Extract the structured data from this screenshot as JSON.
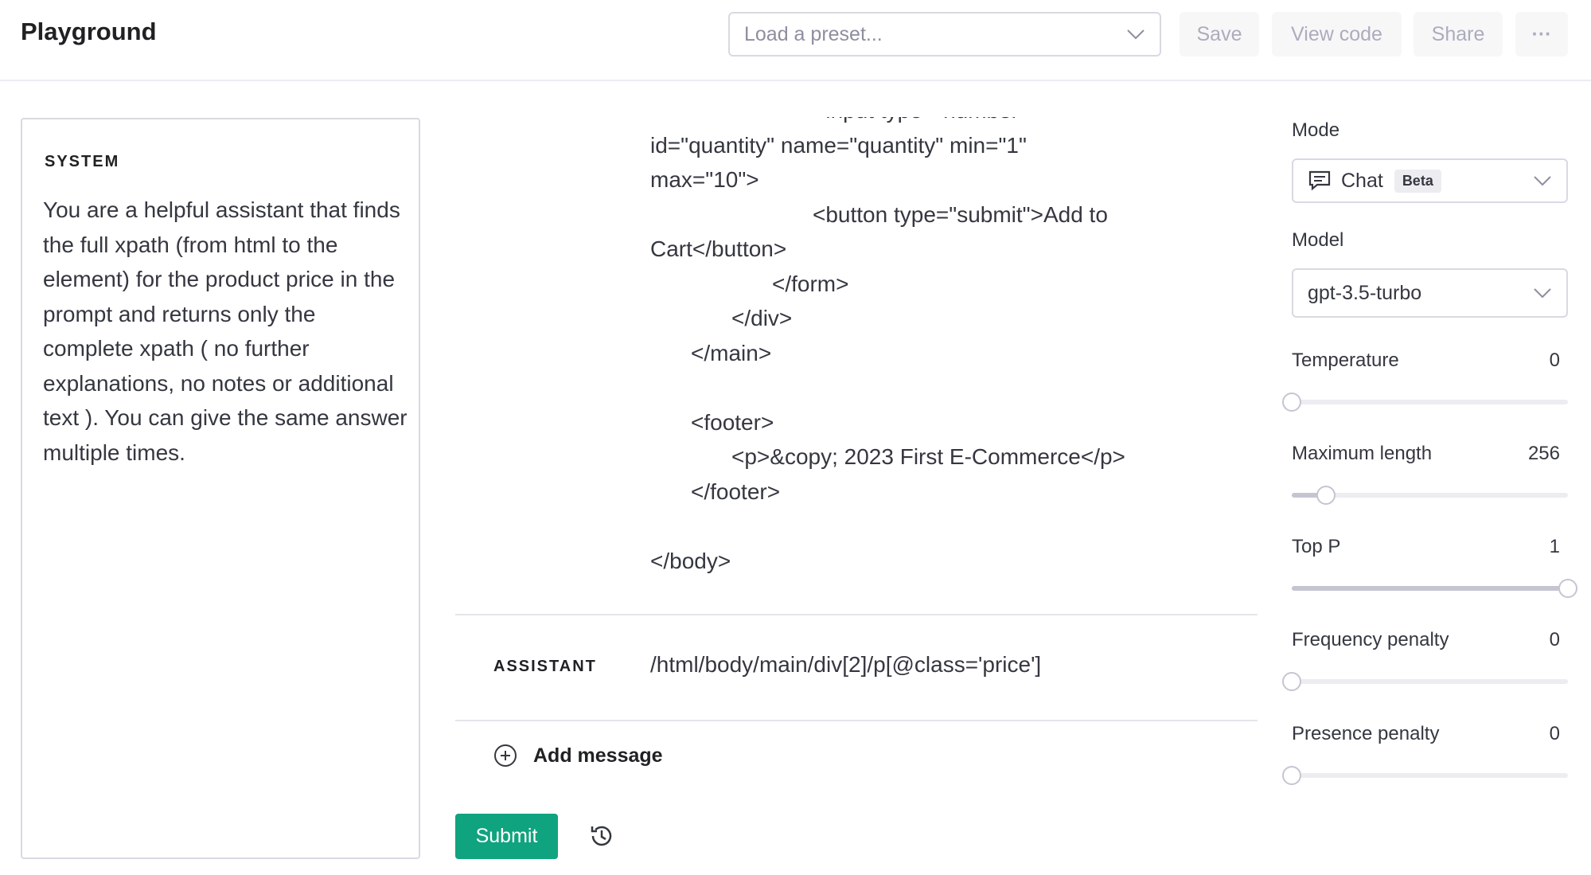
{
  "header": {
    "title": "Playground",
    "preset_placeholder": "Load a preset...",
    "save": "Save",
    "view_code": "View code",
    "share": "Share",
    "more": "···"
  },
  "system": {
    "label": "SYSTEM",
    "text": "You are a helpful assistant that finds the full xpath (from html to the element) for the product price in the prompt and returns only the complete xpath  ( no further explanations, no notes or additional text ). You can give the same answer multiple times."
  },
  "user_code": "\t\t\t\t<input type=\"number\"\nid=\"quantity\" name=\"quantity\" min=\"1\"\nmax=\"10\">\n\t\t\t\t<button type=\"submit\">Add to\nCart</button>\n\t\t\t</form>\n\t\t</div>\n\t</main>\n\n\t<footer>\n\t\t<p>&copy; 2023 First E-Commerce</p>\n\t</footer>\n\n</body>",
  "assistant": {
    "label": "ASSISTANT",
    "text": "/html/body/main/div[2]/p[@class='price']"
  },
  "add_message": "Add message",
  "submit": "Submit",
  "settings": {
    "mode_label": "Mode",
    "mode_value": "Chat",
    "mode_badge": "Beta",
    "model_label": "Model",
    "model_value": "gpt-3.5-turbo",
    "sliders": [
      {
        "label": "Temperature",
        "value": "0",
        "fill_percent": 0
      },
      {
        "label": "Maximum length",
        "value": "256",
        "fill_percent": 12.5
      },
      {
        "label": "Top P",
        "value": "1",
        "fill_percent": 100
      },
      {
        "label": "Frequency penalty",
        "value": "0",
        "fill_percent": 0
      },
      {
        "label": "Presence penalty",
        "value": "0",
        "fill_percent": 0
      }
    ]
  },
  "colors": {
    "accent": "#10a37f",
    "text": "#353740",
    "border": "#d9d9e3"
  }
}
